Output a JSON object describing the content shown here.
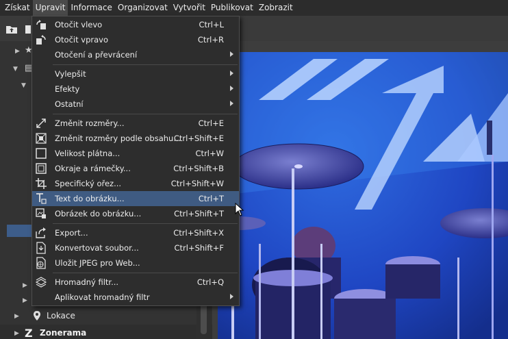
{
  "menubar": {
    "items": [
      {
        "label": "Získat"
      },
      {
        "label": "Upravit"
      },
      {
        "label": "Informace"
      },
      {
        "label": "Organizovat"
      },
      {
        "label": "Vytvořit"
      },
      {
        "label": "Publikovat"
      },
      {
        "label": "Zobrazit"
      }
    ]
  },
  "tree": {
    "location_label": "Lokace",
    "zonerama_label": "Zonerama"
  },
  "menu": {
    "items": [
      {
        "label": "Otočit vlevo",
        "shortcut": "Ctrl+L",
        "icon": "rotate-left-icon"
      },
      {
        "label": "Otočit vpravo",
        "shortcut": "Ctrl+R",
        "icon": "rotate-right-icon"
      },
      {
        "label": "Otočení a převrácení",
        "shortcut": "",
        "icon": ""
      },
      {
        "label": "Vylepšit",
        "shortcut": "",
        "icon": ""
      },
      {
        "label": "Efekty",
        "shortcut": "",
        "icon": ""
      },
      {
        "label": "Ostatní",
        "shortcut": "",
        "icon": ""
      },
      {
        "label": "Změnit rozměry...",
        "shortcut": "Ctrl+E",
        "icon": "resize-icon"
      },
      {
        "label": "Změnit rozměry podle obsahu...",
        "shortcut": "Ctrl+Shift+E",
        "icon": "content-resize-icon"
      },
      {
        "label": "Velikost plátna...",
        "shortcut": "Ctrl+W",
        "icon": "canvas-size-icon"
      },
      {
        "label": "Okraje a rámečky...",
        "shortcut": "Ctrl+Shift+B",
        "icon": "border-icon"
      },
      {
        "label": "Specifický ořez...",
        "shortcut": "Ctrl+Shift+W",
        "icon": "crop-icon"
      },
      {
        "label": "Text do obrázku...",
        "shortcut": "Ctrl+T",
        "icon": "text-icon"
      },
      {
        "label": "Obrázek do obrázku...",
        "shortcut": "Ctrl+Shift+T",
        "icon": "picture-in-picture-icon"
      },
      {
        "label": "Export...",
        "shortcut": "Ctrl+Shift+X",
        "icon": "export-icon"
      },
      {
        "label": "Konvertovat soubor...",
        "shortcut": "Ctrl+Shift+F",
        "icon": "convert-file-icon"
      },
      {
        "label": "Uložit JPEG pro Web...",
        "shortcut": "",
        "icon": "save-web-icon"
      },
      {
        "label": "Hromadný filtr...",
        "shortcut": "Ctrl+Q",
        "icon": "batch-filter-icon"
      },
      {
        "label": "Aplikovat hromadný filtr",
        "shortcut": "",
        "icon": ""
      }
    ]
  },
  "colors": {
    "menu_bg": "#2d2d2d",
    "highlight": "#3f5b82",
    "photo_blue": "#1d3fb9"
  }
}
